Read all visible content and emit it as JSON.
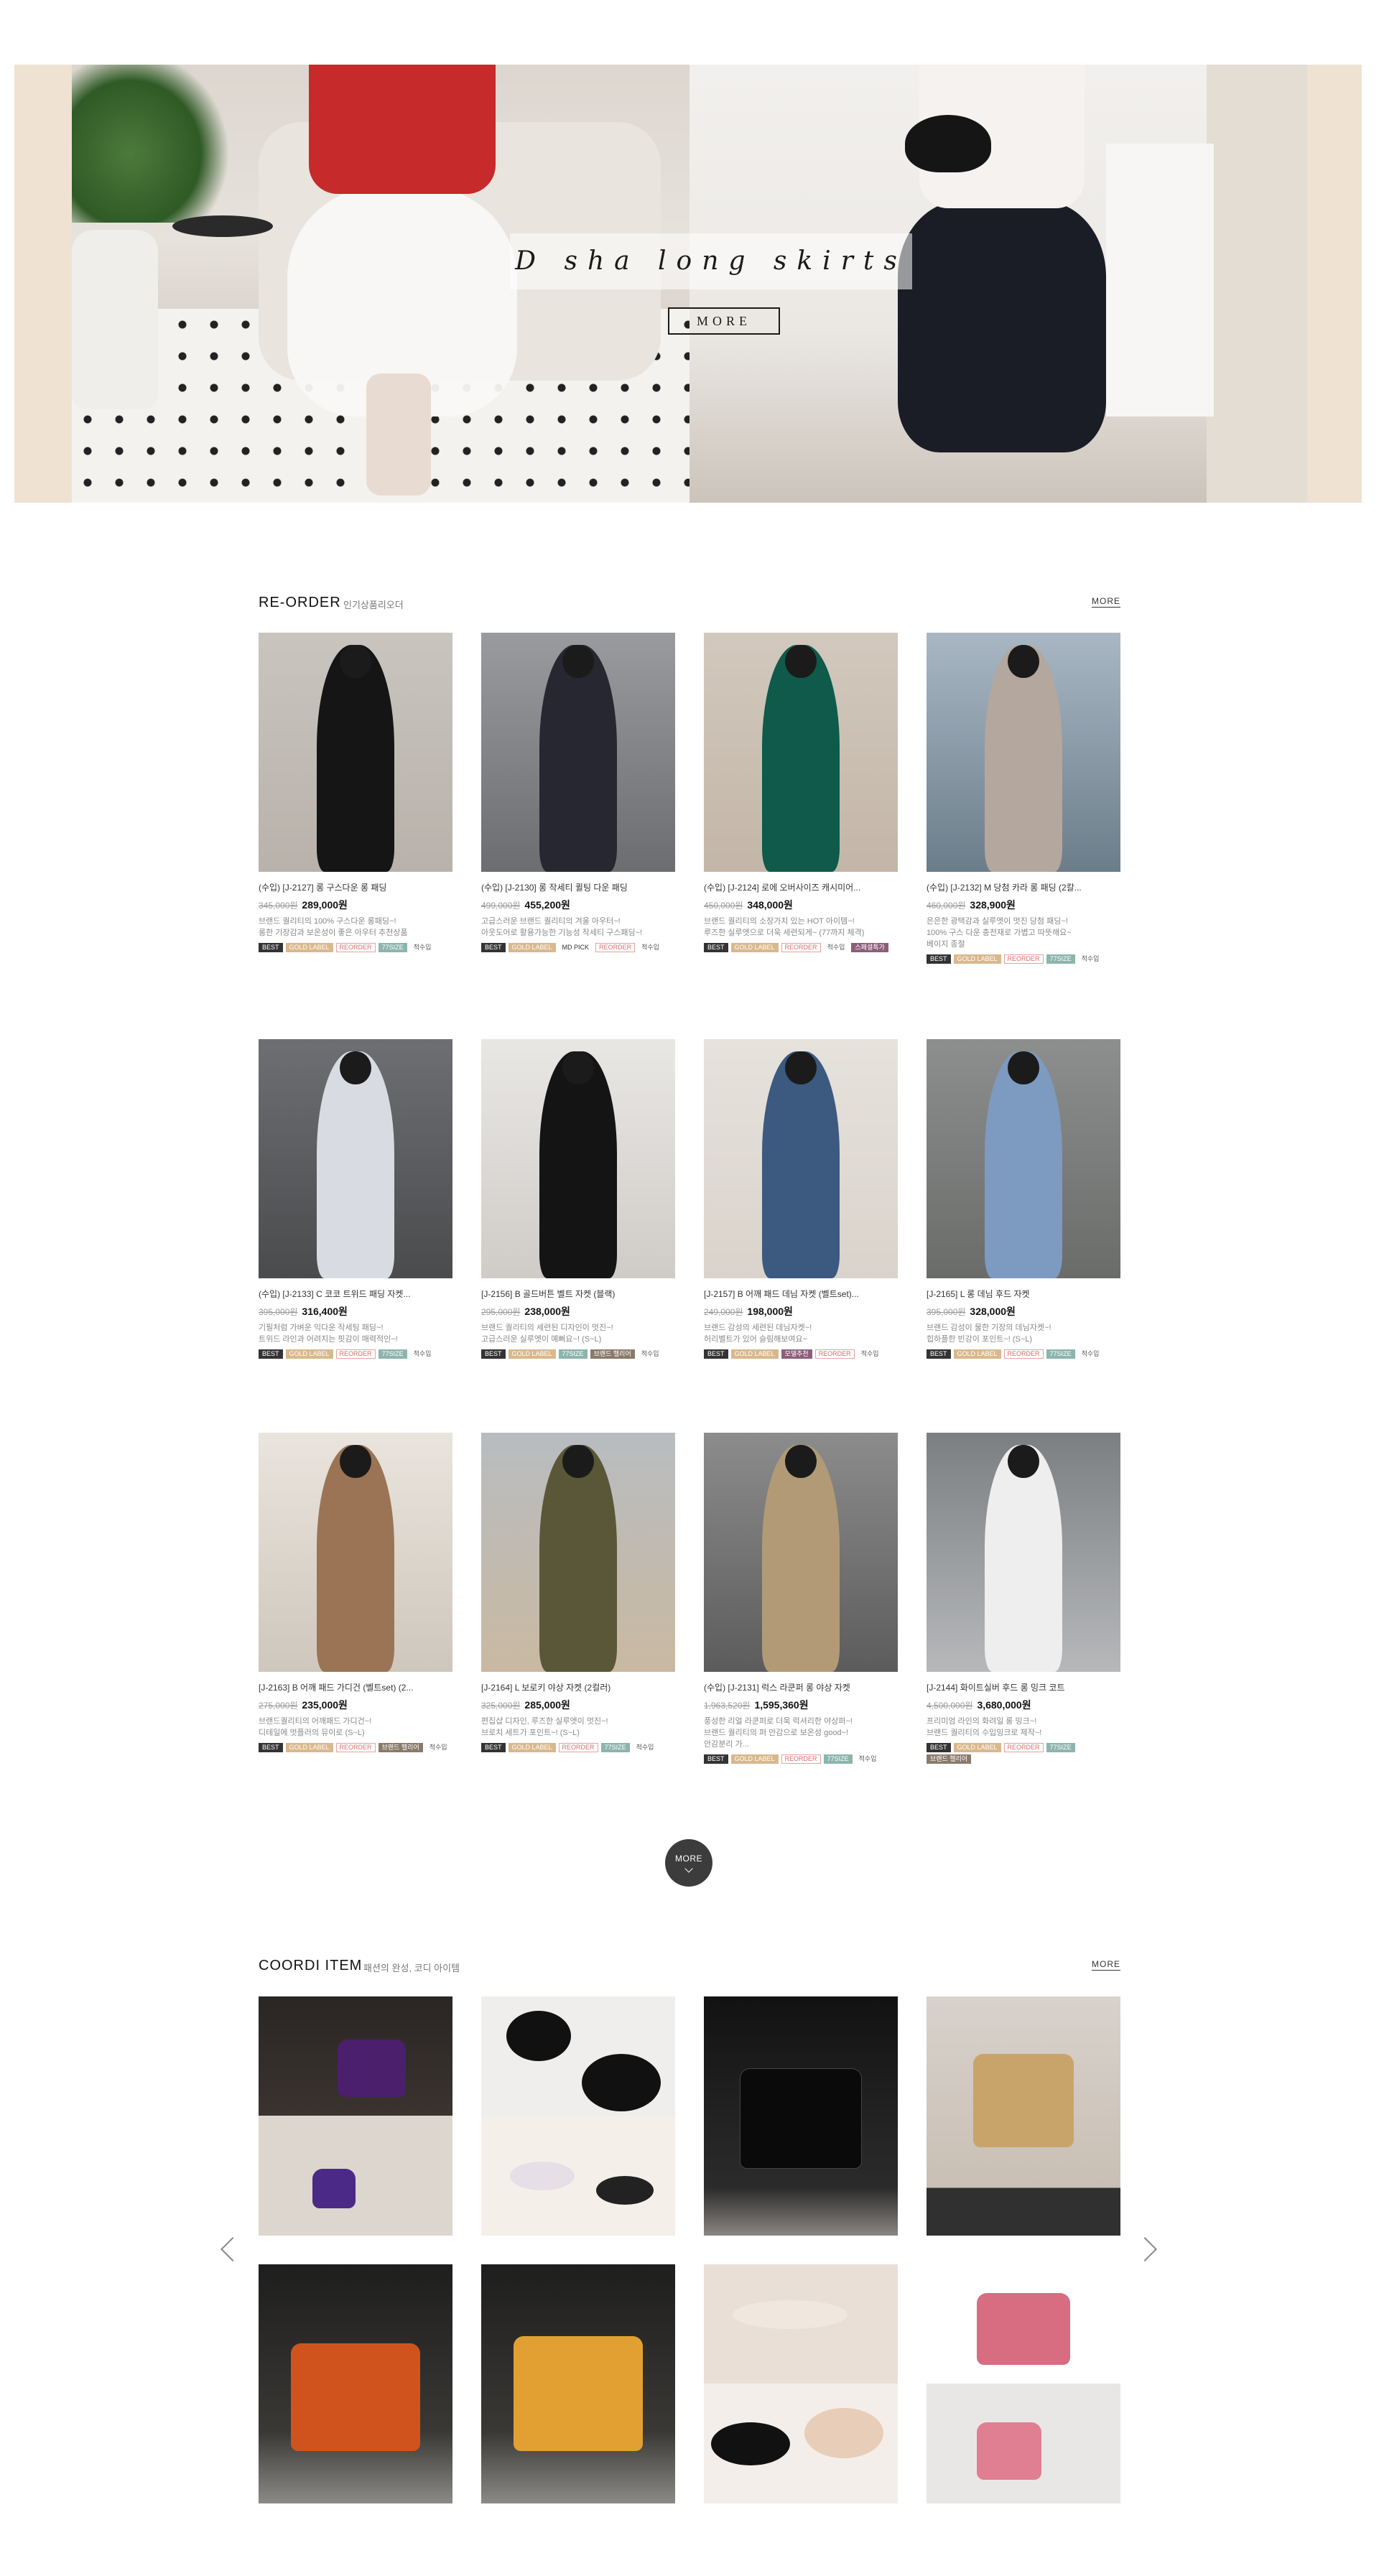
{
  "hero": {
    "caption": "D sha long skirts",
    "more_label": "MORE"
  },
  "reorder": {
    "title": "RE-ORDER",
    "subtitle": "인기상품리오더",
    "more_label": "MORE",
    "products": [
      {
        "name": "(수입) [J-2127] 롱 구스다운 롱 패딩",
        "old": "345,000원",
        "new": "289,000원",
        "desc": [
          "브랜드 퀄리티의 100% 구스다운 롱패딩~!",
          "롱한 기장감과 보온성이 좋은 아우터 추천상품"
        ],
        "badges": [
          "BEST",
          "GOLD LABEL",
          "REORDER",
          "77SIZE",
          "적수입"
        ]
      },
      {
        "name": "(수입) [J-2130] 롱 작세티 퀼팅 다운 패딩",
        "old": "499,000원",
        "new": "455,200원",
        "desc": [
          "고급스러운 브랜드 퀄리티의 겨울 아우터~!",
          "아웃도어로 활용가능한 기능성 작세티 구스패딩~!"
        ],
        "badges": [
          "BEST",
          "GOLD LABEL",
          "MD PICK",
          "REORDER",
          "적수입"
        ]
      },
      {
        "name": "(수입) [J-2124] 로에 오버사이즈 캐시미어...",
        "old": "450,000원",
        "new": "348,000원",
        "desc": [
          "브랜드 퀄리티의 소장가치 있는 HOT 아이템~!",
          "루즈한 실루엣으로 더욱 세련되게~ (77까지 체격)"
        ],
        "badges": [
          "BEST",
          "GOLD LABEL",
          "REORDER",
          "적수입",
          "스페셜특가"
        ]
      },
      {
        "name": "(수입) [J-2132] M 당첨 카라 롱 패딩 (2칼...",
        "old": "460,000원",
        "new": "328,900원",
        "desc": [
          "은은한 광택감과 실루엣이 멋진 당첨 패딩~!",
          "100% 구스 다운 충전재로 가볍고 따뜻해요~",
          "베이지 종절"
        ],
        "badges": [
          "BEST",
          "GOLD LABEL",
          "REORDER",
          "77SIZE",
          "적수입"
        ]
      },
      {
        "name": "(수입) [J-2133] C 코코 트위드 패딩 자켓...",
        "old": "395,000원",
        "new": "316,400원",
        "desc": [
          "기필처럼 가벼운 익다운 작세팅 패딩~!",
          "트위드 라인과 어려지는 핏감이 매력적인~!"
        ],
        "badges": [
          "BEST",
          "GOLD LABEL",
          "REORDER",
          "77SIZE",
          "적수입"
        ]
      },
      {
        "name": "[J-2156] B 골드버튼 벨트 자켓 (블랙)",
        "old": "295,000원",
        "new": "238,000원",
        "desc": [
          "브랜드 퀄리티의 세련된 디자인이 멋진~!",
          "고급스러운 실루엣이 예뻐요~! (S~L)"
        ],
        "badges": [
          "BEST",
          "GOLD LABEL",
          "77SIZE",
          "브랜드 헬리어",
          "적수입"
        ]
      },
      {
        "name": "[J-2157] B 어깨 패드 데님 자켓 (벨트set)...",
        "old": "249,000원",
        "new": "198,000원",
        "desc": [
          "브랜드 감성의 세련된 데님자켓~!",
          "허리벨트가 있어 슬림해보여요~"
        ],
        "badges": [
          "BEST",
          "GOLD LABEL",
          "모델추천",
          "REORDER",
          "적수입"
        ]
      },
      {
        "name": "[J-2165] L 롱 데님 후드 자켓",
        "old": "395,000원",
        "new": "328,000원",
        "desc": [
          "브랜드 감성이 물한 기장의 데님자켓~!",
          "힙하플한 빈강이 포인트~! (S~L)"
        ],
        "badges": [
          "BEST",
          "GOLD LABEL",
          "REORDER",
          "77SIZE",
          "적수입"
        ]
      },
      {
        "name": "[J-2163] B 어깨 패드 가디건 (벨트set) (2...",
        "old": "275,000원",
        "new": "235,000원",
        "desc": [
          "브랜드퀄리티의 어깨패드 가디건~!",
          "디테일에 멋플러의 뮤이로 (S~L)"
        ],
        "badges": [
          "BEST",
          "GOLD LABEL",
          "REORDER",
          "브랜드 헬리어",
          "적수입"
        ]
      },
      {
        "name": "[J-2164] L 보로키 야상 자켓 (2컬러)",
        "old": "325,000원",
        "new": "285,000원",
        "desc": [
          "편집샵 디자인, 루즈한 실루엣이 멋진~!",
          "브로치 세트가 포인트~! (S~L)"
        ],
        "badges": [
          "BEST",
          "GOLD LABEL",
          "REORDER",
          "77SIZE",
          "적수입"
        ]
      },
      {
        "name": "(수입) [J-2131] 럭스 라쿤퍼 롱 야상 자켓",
        "old": "1,963,520원",
        "new": "1,595,360원",
        "desc": [
          "풍성한 리얼 라쿤퍼로 더욱 럭셔리한 야상퍼~!",
          "브랜드 퀄리티의 퍼 안감으로 보온성 good~!",
          "안감분리 가..."
        ],
        "badges": [
          "BEST",
          "GOLD LABEL",
          "REORDER",
          "77SIZE",
          "적수입"
        ]
      },
      {
        "name": "[J-2144] 화이트실버 후드 롱 밍크 코트",
        "old": "4,500,000원",
        "new": "3,680,000원",
        "desc": [
          "프리미엄 라인의 화려일 롱 밍크~!",
          "브랜드 퀄리티의 수입밍크로 제작~!"
        ],
        "badges": [
          "BEST",
          "GOLD LABEL",
          "REORDER",
          "77SIZE",
          "브랜드 헬리어"
        ]
      }
    ],
    "load_more_label": "MORE"
  },
  "coordi": {
    "title": "COORDI ITEM",
    "subtitle": "패션의 완성, 코디 아이템",
    "more_label": "MORE",
    "prev_label": "previous",
    "next_label": "next"
  },
  "colors": {
    "accent": "#3c3c3c",
    "hero_bg": "#efe2d2",
    "badge_gold": "#d9b88c",
    "badge_reorder": "#d56d6d",
    "badge_new": "#8cb5ad"
  }
}
